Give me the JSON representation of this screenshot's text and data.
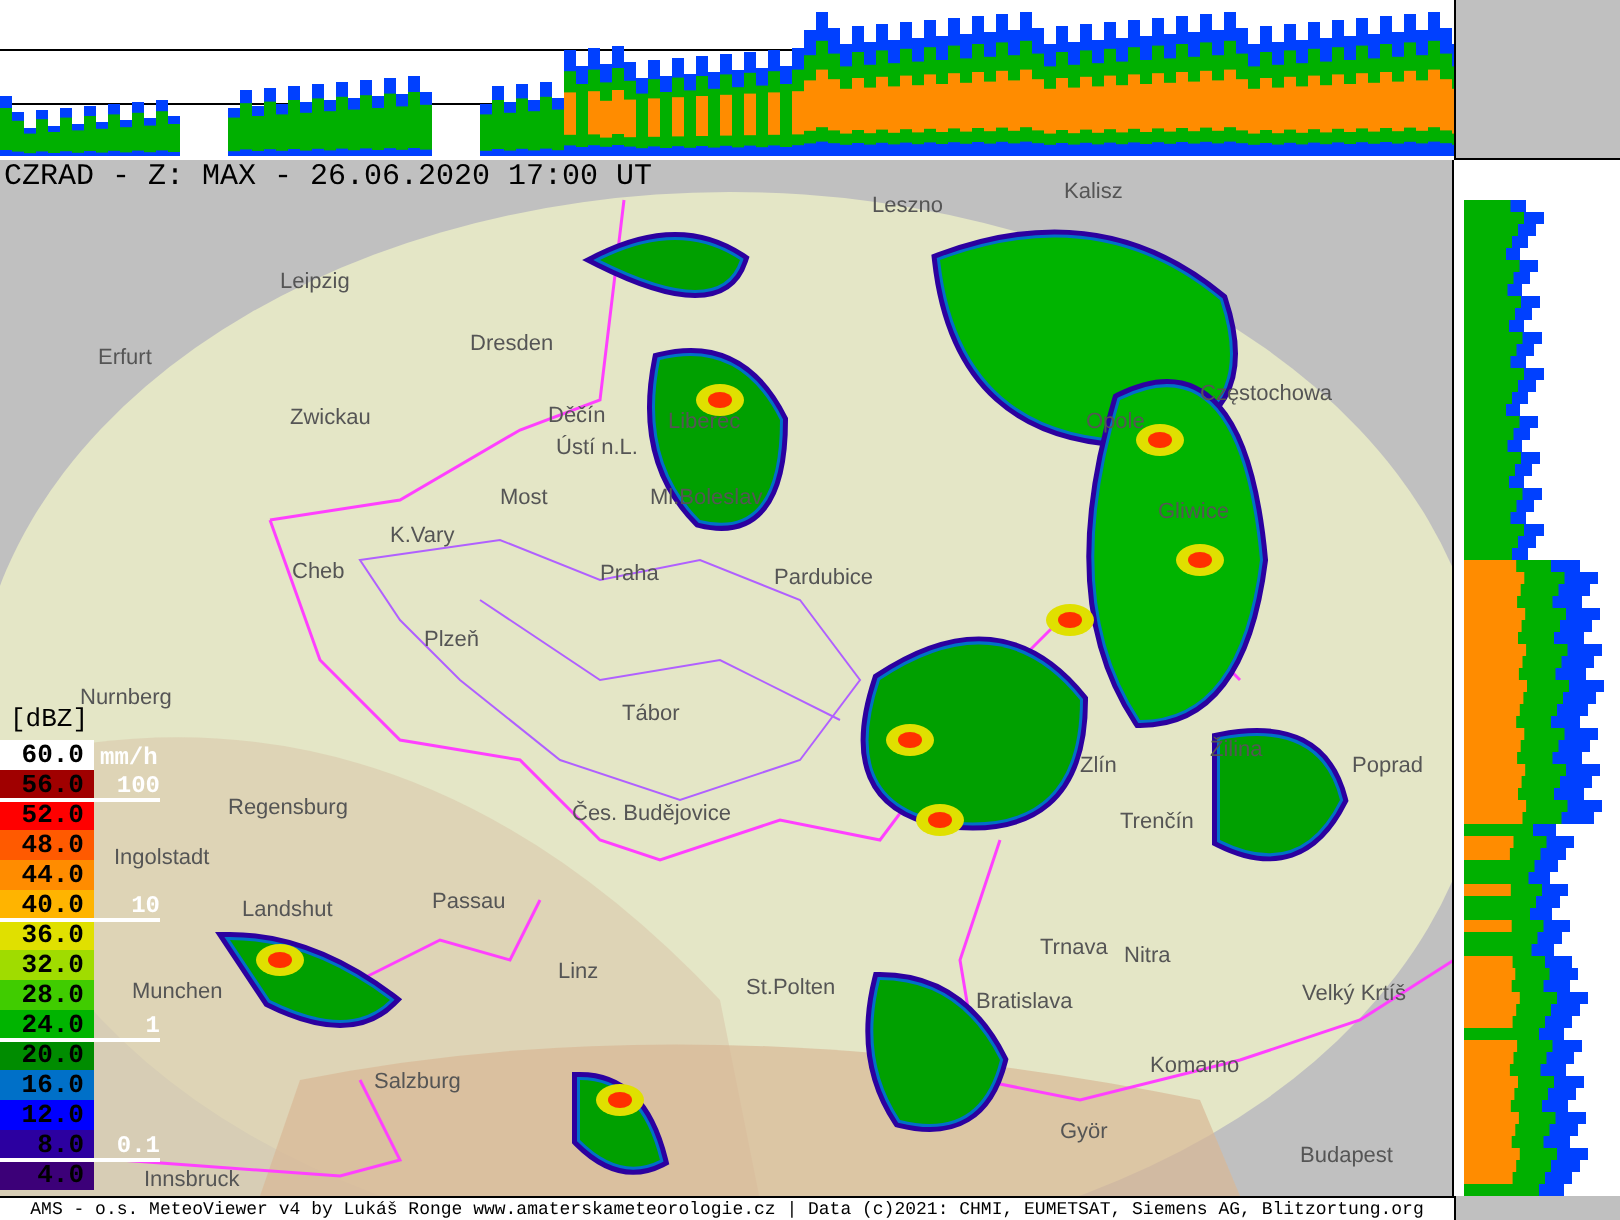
{
  "title": "CZRAD - Z: MAX - 26.06.2020 17:00 UT",
  "cities": [
    "Leszno",
    "Kalisz",
    "Leipzig",
    "Erfurt",
    "Dresden",
    "Zwickau",
    "Děčín",
    "Ústí n.L.",
    "Most",
    "K.Vary",
    "Cheb",
    "Plzeň",
    "Praha",
    "Liberec",
    "Ml.Boleslav",
    "Pardubice",
    "Opole",
    "Częstochowa",
    "Gliwice",
    "Nurnberg",
    "Regensburg",
    "Ingolstadt",
    "Landshut",
    "Munchen",
    "Passau",
    "Tábor",
    "Čes. Budějovice",
    "Linz",
    "St.Polten",
    "Salzburg",
    "Innsbruck",
    "Zlín",
    "Žilina",
    "Trenčín",
    "Poprad",
    "Trnava",
    "Nitra",
    "Bratislava",
    "Velký Krtíš",
    "Komarno",
    "Györ",
    "Budapest"
  ],
  "legend": {
    "unit": "[dBZ]",
    "items": [
      {
        "label": "60.0",
        "color": "#ffffff"
      },
      {
        "label": "56.0",
        "color": "#a00000"
      },
      {
        "label": "52.0",
        "color": "#ff0000"
      },
      {
        "label": "48.0",
        "color": "#ff5a00"
      },
      {
        "label": "44.0",
        "color": "#ff8c00"
      },
      {
        "label": "40.0",
        "color": "#ffb400"
      },
      {
        "label": "36.0",
        "color": "#e0e000"
      },
      {
        "label": "32.0",
        "color": "#a0dc00"
      },
      {
        "label": "28.0",
        "color": "#40cc00"
      },
      {
        "label": "24.0",
        "color": "#00b400"
      },
      {
        "label": "20.0",
        "color": "#008c00"
      },
      {
        "label": "16.0",
        "color": "#0070c8"
      },
      {
        "label": "12.0",
        "color": "#0000ff"
      },
      {
        "label": "8.0",
        "color": "#2c00a0"
      },
      {
        "label": "4.0",
        "color": "#3c0078"
      }
    ]
  },
  "rain_scale": {
    "unit": "mm/h",
    "marks": [
      "100",
      "10",
      "1",
      "0.1"
    ]
  },
  "footer": "AMS - o.s. MeteoViewer v4 by Lukáš Ronge www.amaterskameteorologie.cz | Data (c)2021: CHMI, EUMETSAT, Siemens AG, Blitzortung.org"
}
